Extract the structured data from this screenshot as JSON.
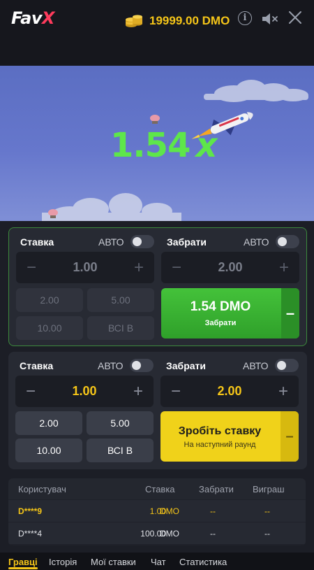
{
  "header": {
    "logo_main": "Fav",
    "logo_accent": "X",
    "balance": "19999.00 DMO",
    "icons": [
      "coins-icon",
      "info-icon",
      "mute-icon",
      "close-icon"
    ]
  },
  "game": {
    "multiplier_value": "1.54",
    "multiplier_symbol": "x",
    "colors": {
      "sky": "#6677cc",
      "multiplier": "#5ee64a"
    }
  },
  "bet_panel_1": {
    "bet_label": "Ставка",
    "auto_label": "АВТО",
    "cashout_label": "Забрати",
    "cashout_auto_label": "АВТО",
    "bet_amount": "1.00",
    "cashout_amount": "2.00",
    "quick_bets": [
      "2.00",
      "5.00",
      "10.00",
      "ВСІ В"
    ],
    "cashout_button": {
      "amount": "1.54 DMO",
      "label": "Забрати",
      "side": "–"
    }
  },
  "bet_panel_2": {
    "bet_label": "Ставка",
    "auto_label": "АВТО",
    "cashout_label": "Забрати",
    "cashout_auto_label": "АВТО",
    "bet_amount": "1.00",
    "cashout_amount": "2.00",
    "quick_bets": [
      "2.00",
      "5.00",
      "10.00",
      "ВСІ В"
    ],
    "place_bet_button": {
      "title": "Зробіть ставку",
      "sub": "На наступний раунд",
      "side": "–"
    }
  },
  "bets_table": {
    "headers": [
      "Користувач",
      "Ставка",
      "Забрати",
      "Виграш"
    ],
    "rows": [
      {
        "user": "D****9",
        "bet": "1.00",
        "currency": "DMO",
        "cashout": "--",
        "win": "--"
      },
      {
        "user": "D****4",
        "bet": "100.00",
        "currency": "DMO",
        "cashout": "--",
        "win": "--"
      }
    ]
  },
  "tabs": [
    "Гравці",
    "Історія",
    "Мої ставки",
    "Чат",
    "Статистика"
  ],
  "active_tab": "Гравці"
}
